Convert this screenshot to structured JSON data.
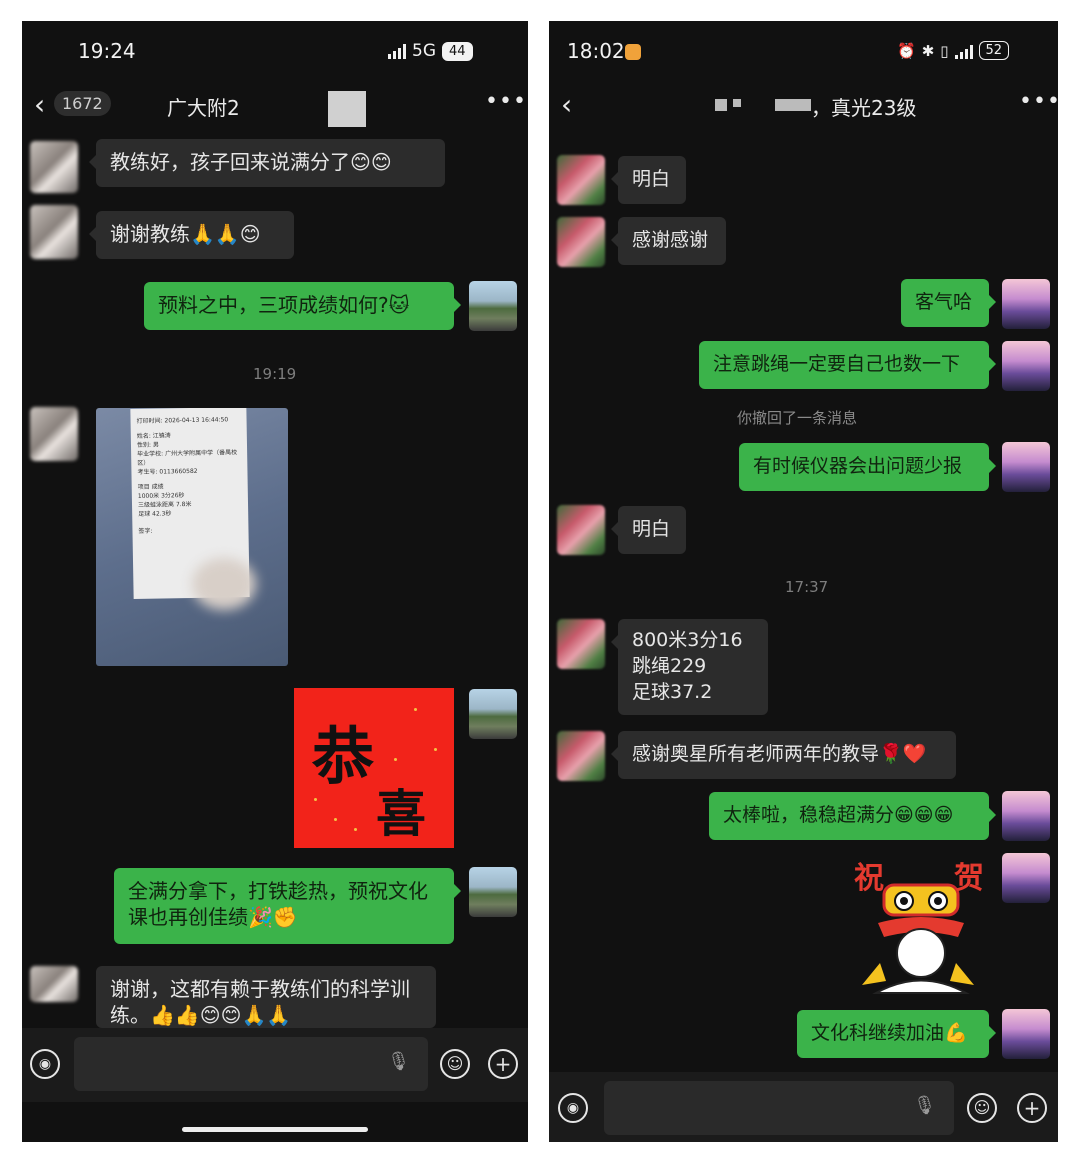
{
  "left": {
    "status": {
      "time": "19:24",
      "network": "5G",
      "battery": "44"
    },
    "nav": {
      "unread_count": "1672",
      "title": "广大附2"
    },
    "messages": {
      "m1": "教练好，孩子回来说满分了😊😊",
      "m2": "谢谢教练🙏🙏😊",
      "m3": "预料之中，三项成绩如何?🐱",
      "m4": "全满分拿下，打铁趁热，预祝文化课也再创佳绩🎉✊",
      "m5": "谢谢，这都有赖于教练们的科学训练。👍👍😊😊🙏🙏"
    },
    "timestamp": "19:19",
    "receipt": {
      "lines": [
        "打印时间: 2026-04-13 16:44:50",
        "姓名: 江镇涛",
        "性别: 男",
        "毕业学校: 广州大学附属中学（番禺校区）",
        "考生号: 0113660582",
        "项目                    成绩",
        "1000米                3分26秒",
        "三级蛙泳距离          7.8米",
        "足球                  42.3秒",
        "签字:"
      ]
    },
    "sticker": {
      "char1": "恭",
      "char2": "喜"
    }
  },
  "right": {
    "status": {
      "time": "18:02",
      "battery": "52"
    },
    "nav": {
      "title": "，真光23级"
    },
    "messages": {
      "r1": "明白",
      "r2": "感谢感谢",
      "r3": "客气哈",
      "r4": "注意跳绳一定要自己也数一下",
      "r5": "有时候仪器会出问题少报",
      "r6": "明白",
      "r7": "800米3分16\n跳绳229\n足球37.2",
      "r8": "感谢奥星所有老师两年的教导🌹❤️",
      "r9": "太棒啦，稳稳超满分😁😁😁",
      "r10": "文化科继续加油💪"
    },
    "system_msg": "你撤回了一条消息",
    "timestamp": "17:37",
    "sticker": {
      "char1": "祝",
      "char2": "贺"
    }
  }
}
